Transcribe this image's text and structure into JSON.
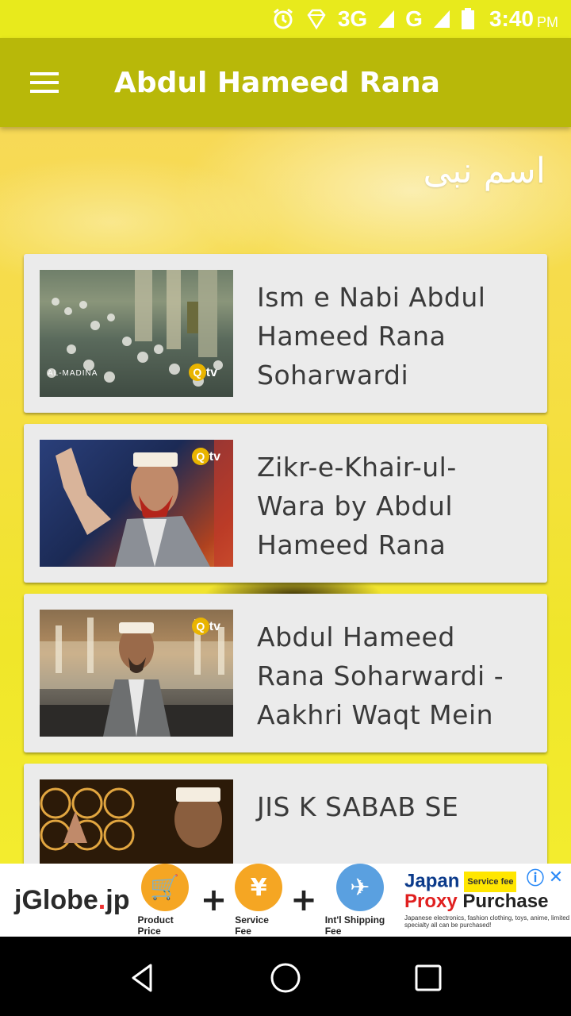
{
  "status_bar": {
    "network": "3G",
    "roaming": "G",
    "time": "3:40",
    "ampm": "PM"
  },
  "app_bar": {
    "title": "Abdul Hameed Rana"
  },
  "section": {
    "title": "اسم نبی"
  },
  "items": [
    {
      "title": "Ism e Nabi Abdul Hameed Rana Soharwardi",
      "thumb_text": "AL-MADINA",
      "channel": "tv"
    },
    {
      "title": "Zikr-e-Khair-ul-Wara by Abdul Hameed Rana",
      "channel": "tv"
    },
    {
      "title": "Abdul Hameed Rana Soharwardi - Aakhri Waqt Mein",
      "channel": "tv"
    },
    {
      "title": "JIS K SABAB SE"
    }
  ],
  "ad": {
    "logo": "jGlobe",
    "logo_dot": ".",
    "logo_tld": "jp",
    "step1_symbol": "🛒",
    "step1_caption": "Product Price",
    "step2_symbol": "¥",
    "step2_caption": "Service Fee",
    "step3_symbol": "✈",
    "step3_caption": "Int'l Shipping Fee",
    "plus": "+",
    "headline_1": "Japan",
    "fee_badge": "Service fee",
    "headline_2_red": "Proxy",
    "headline_2_dark": "Purchase",
    "small_text": "Japanese electronics, fashion clothing, toys, anime, limited specialty all can be purchased!",
    "info_symbol": "ⓘ",
    "close_symbol": "✕"
  },
  "colors": {
    "status_bar": "#e8ea1c",
    "app_bar": "#b8b809",
    "card": "#ebebeb",
    "card_text": "#3a3a3a"
  },
  "icons": {
    "menu": "hamburger-menu-icon",
    "back": "back-triangle-icon",
    "home": "home-circle-icon",
    "recents": "recents-square-icon"
  }
}
